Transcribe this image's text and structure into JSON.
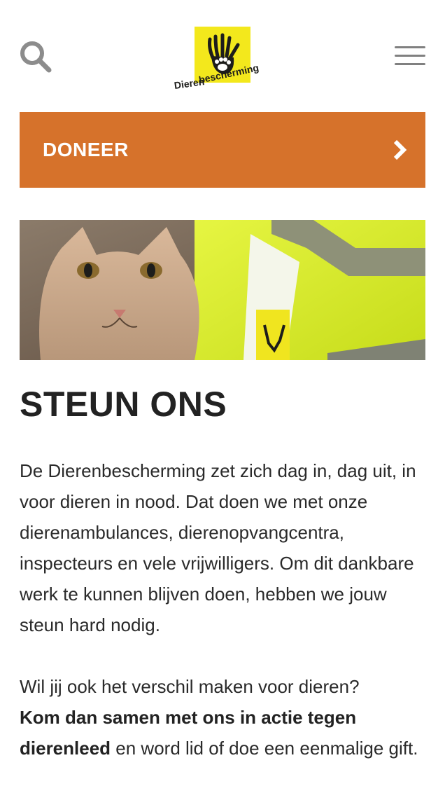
{
  "header": {
    "logo": {
      "line1": "Dieren",
      "line2": "bescherming",
      "color": "#f3e81c"
    },
    "search_icon": "search-icon",
    "menu_icon": "hamburger-menu-icon"
  },
  "donate": {
    "label": "DONEER",
    "icon": "chevron-right-icon",
    "color": "#d6722b"
  },
  "hero": {
    "description_icon": "hero-image"
  },
  "main": {
    "title": "STEUN ONS",
    "intro": "De Dierenbescherming zet zich dag in, dag uit, in voor dieren in nood. Dat doen we met onze dierenambulances, dierenopvangcentra, inspecteurs en vele vrijwilligers. Om dit dankbare werk te kunnen blijven doen, hebben we jouw steun hard nodig.",
    "cta_lead": "Wil jij ook het verschil maken voor dieren?",
    "cta_bold": "Kom dan samen met ons in actie tegen dierenleed",
    "cta_tail": " en word lid of doe een eenmalige gift."
  }
}
